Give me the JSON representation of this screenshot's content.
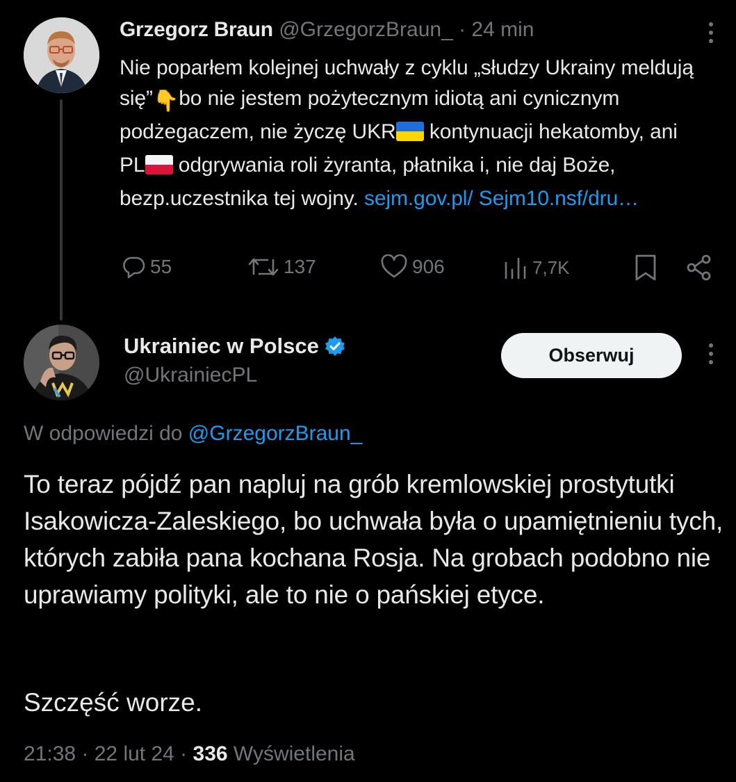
{
  "original_tweet": {
    "author_name": "Grzegorz Braun",
    "author_handle": "@GrzegorzBraun_",
    "time_sep": " · ",
    "time": "24 min",
    "text_1": "Nie poparłem kolejnej uchwały z cyklu „słudzy Ukrainy meldują się”",
    "emoji_point": "👇",
    "text_2": "bo nie jestem pożytecznym idiotą ani cynicznym podżegaczem, nie życzę UKR",
    "text_3": " kontynuacji hekatomby, ani PL",
    "text_4": " odgrywania roli żyranta, płatnika i, nie daj Boże, bezp.uczestnika tej wojny. ",
    "link": "sejm.gov.pl/ Sejm10.nsf/dru…",
    "actions": {
      "replies": "55",
      "retweets": "137",
      "likes": "906",
      "views": "7,7K"
    }
  },
  "reply_tweet": {
    "author_name": "Ukrainiec w Polsce",
    "author_handle": "@UkrainiecPL",
    "follow_label": "Obserwuj",
    "reply_prefix": "W odpowiedzi do ",
    "reply_to_handle": "@GrzegorzBraun_",
    "text": "To teraz pójdź pan napluj na grób kremlowskiej prostytutki Isakowicza-Zaleskiego, bo uchwała była o upamiętnieniu tych, których zabiła pana kochana Rosja. Na grobach podobno nie uprawiamy polityki, ale to nie o pańskiej etyce.",
    "sign_off": "Szczęść worze.",
    "time": "21:38",
    "sep": " · ",
    "date": "22 lut 24",
    "views_count": "336",
    "views_label": " Wyświetlenia"
  },
  "colors": {
    "background": "#000000",
    "text": "#e7e9ea",
    "muted": "#71767b",
    "link": "#1d9bf0",
    "verified": "#1d9bf0"
  },
  "icons": [
    "more-dots-icon",
    "reply-icon",
    "retweet-icon",
    "like-icon",
    "views-icon",
    "bookmark-icon",
    "share-icon",
    "verified-badge-icon"
  ]
}
